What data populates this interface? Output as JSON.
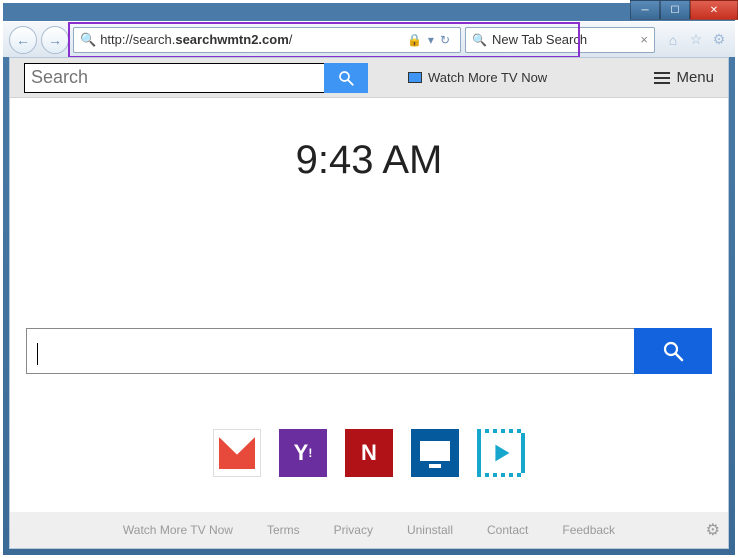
{
  "window": {
    "url_prefix": "http://search.",
    "url_host": "searchwmtn2.com",
    "url_suffix": "/",
    "tab_title": "New Tab Search"
  },
  "topbar": {
    "search_placeholder": "Search",
    "brand_label": "Watch More TV Now",
    "menu_label": "Menu"
  },
  "clock": {
    "time": "9:43 AM"
  },
  "quicklinks": {
    "yahoo_letter": "Y",
    "netflix_letter": "N"
  },
  "footer": {
    "links": {
      "brand": "Watch More TV Now",
      "terms": "Terms",
      "privacy": "Privacy",
      "uninstall": "Uninstall",
      "contact": "Contact",
      "feedback": "Feedback"
    }
  }
}
